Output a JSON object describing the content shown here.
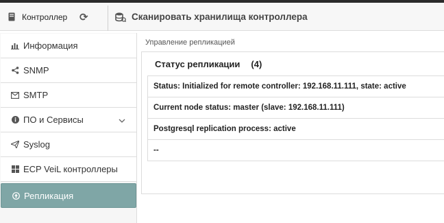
{
  "header": {
    "controller_label": "Контроллер",
    "controller_icon": "server-icon",
    "refresh_icon": "refresh-icon",
    "scan_icon": "database-icon",
    "scan_label": "Сканировать хранилища контроллера"
  },
  "sidebar": {
    "items": [
      {
        "label": "Информация",
        "icon": "bar-chart-icon"
      },
      {
        "label": "SNMP",
        "icon": "share-icon"
      },
      {
        "label": "SMTP",
        "icon": "envelope-icon"
      },
      {
        "label": "ПО и Сервисы",
        "icon": "info-icon",
        "has_dropdown": true
      },
      {
        "label": "Syslog",
        "icon": "paper-plane-icon"
      },
      {
        "label": "ECP VeiL контроллеры",
        "icon": "grid-icon"
      },
      {
        "label": "Репликация",
        "icon": "arrow-circle-up-icon",
        "active": true
      }
    ],
    "active_color": "#7fa6a6"
  },
  "main": {
    "section_title": "Управление репликацией",
    "panel": {
      "title": "Статус репликации",
      "count": "(4)",
      "rows": [
        "Status: Initialized for remote controller: 192.168.11.111, state: active",
        "Current node status: master (slave: 192.168.11.111)",
        "Postgresql replication process: active",
        "--"
      ]
    }
  }
}
